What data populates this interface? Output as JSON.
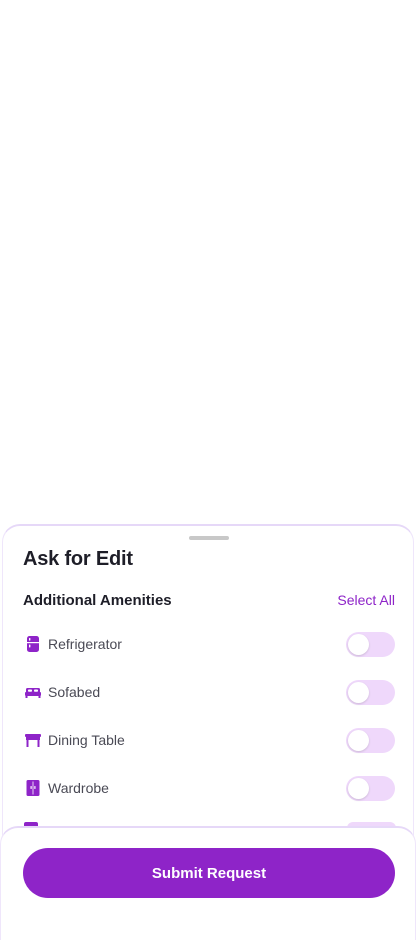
{
  "sheet": {
    "title": "Ask for Edit",
    "section_title": "Additional Amenities",
    "select_all_label": "Select All"
  },
  "amenities": [
    {
      "label": "Refrigerator",
      "icon": "refrigerator-icon",
      "enabled": false
    },
    {
      "label": "Sofabed",
      "icon": "sofabed-icon",
      "enabled": false
    },
    {
      "label": "Dining Table",
      "icon": "dining-table-icon",
      "enabled": false
    },
    {
      "label": "Wardrobe",
      "icon": "wardrobe-icon",
      "enabled": false
    }
  ],
  "footer": {
    "submit_label": "Submit Request"
  },
  "colors": {
    "accent": "#8e24c8",
    "toggle_off_track": "#efd8fb"
  }
}
